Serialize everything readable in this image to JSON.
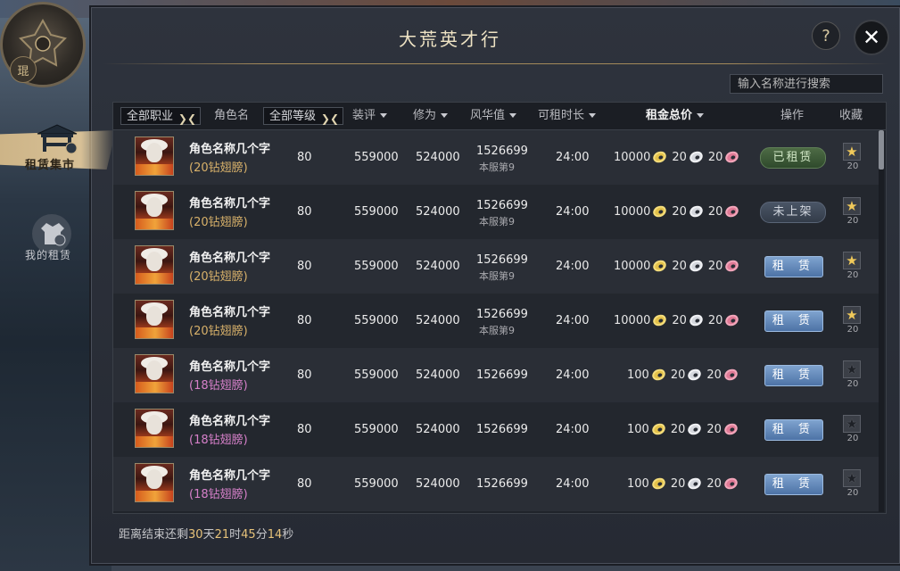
{
  "title": "大荒英才行",
  "search": {
    "placeholder": "输入名称进行搜索"
  },
  "emblem": {
    "seal_text": "琨"
  },
  "side_tabs": [
    {
      "label": "租赁集市",
      "active": true
    },
    {
      "label": "我的租赁",
      "active": false
    }
  ],
  "header": {
    "job_filter": "全部职业",
    "name": "角色名",
    "level_filter": "全部等级",
    "score": "装评",
    "cultivation": "修为",
    "fame": "风华值",
    "duration": "可租时长",
    "total_rent": "租金总价",
    "operation": "操作",
    "favorite": "收藏"
  },
  "rows": [
    {
      "name": "角色名称几个字",
      "wing": "(20钻翅膀)",
      "wing_color": "gold",
      "level": "80",
      "score": "559000",
      "cultivation": "524000",
      "fame": "1526699",
      "rank": "本服第9",
      "duration": "24:00",
      "price_gold": "10000",
      "price_silver": "20",
      "price_pink": "20",
      "op": "已租赁",
      "op_type": "rented",
      "fav_count": "20",
      "fav_on": true
    },
    {
      "name": "角色名称几个字",
      "wing": "(20钻翅膀)",
      "wing_color": "gold",
      "level": "80",
      "score": "559000",
      "cultivation": "524000",
      "fame": "1526699",
      "rank": "本服第9",
      "duration": "24:00",
      "price_gold": "10000",
      "price_silver": "20",
      "price_pink": "20",
      "op": "未上架",
      "op_type": "offshelf",
      "fav_count": "20",
      "fav_on": true
    },
    {
      "name": "角色名称几个字",
      "wing": "(20钻翅膀)",
      "wing_color": "gold",
      "level": "80",
      "score": "559000",
      "cultivation": "524000",
      "fame": "1526699",
      "rank": "本服第9",
      "duration": "24:00",
      "price_gold": "10000",
      "price_silver": "20",
      "price_pink": "20",
      "op": "租 赁",
      "op_type": "rent",
      "fav_count": "20",
      "fav_on": true
    },
    {
      "name": "角色名称几个字",
      "wing": "(20钻翅膀)",
      "wing_color": "gold",
      "level": "80",
      "score": "559000",
      "cultivation": "524000",
      "fame": "1526699",
      "rank": "本服第9",
      "duration": "24:00",
      "price_gold": "10000",
      "price_silver": "20",
      "price_pink": "20",
      "op": "租 赁",
      "op_type": "rent",
      "fav_count": "20",
      "fav_on": true
    },
    {
      "name": "角色名称几个字",
      "wing": "(18钻翅膀)",
      "wing_color": "pink",
      "level": "80",
      "score": "559000",
      "cultivation": "524000",
      "fame": "1526699",
      "rank": "",
      "duration": "24:00",
      "price_gold": "100",
      "price_silver": "20",
      "price_pink": "20",
      "op": "租 赁",
      "op_type": "rent",
      "fav_count": "20",
      "fav_on": false
    },
    {
      "name": "角色名称几个字",
      "wing": "(18钻翅膀)",
      "wing_color": "pink",
      "level": "80",
      "score": "559000",
      "cultivation": "524000",
      "fame": "1526699",
      "rank": "",
      "duration": "24:00",
      "price_gold": "100",
      "price_silver": "20",
      "price_pink": "20",
      "op": "租 赁",
      "op_type": "rent",
      "fav_count": "20",
      "fav_on": false
    },
    {
      "name": "角色名称几个字",
      "wing": "(18钻翅膀)",
      "wing_color": "pink",
      "level": "80",
      "score": "559000",
      "cultivation": "524000",
      "fame": "1526699",
      "rank": "",
      "duration": "24:00",
      "price_gold": "100",
      "price_silver": "20",
      "price_pink": "20",
      "op": "租 赁",
      "op_type": "rent",
      "fav_count": "20",
      "fav_on": false
    }
  ],
  "countdown": {
    "prefix": "距离结束还剩",
    "days": "30",
    "days_unit": "天",
    "hours": "21",
    "hours_unit": "时",
    "minutes": "45",
    "minutes_unit": "分",
    "seconds": "14",
    "seconds_unit": "秒"
  },
  "icons": {
    "help": "question-icon",
    "close": "close-icon",
    "star": "star-icon",
    "dropdown": "chevron-down-icon",
    "sort": "caret-down-icon"
  }
}
